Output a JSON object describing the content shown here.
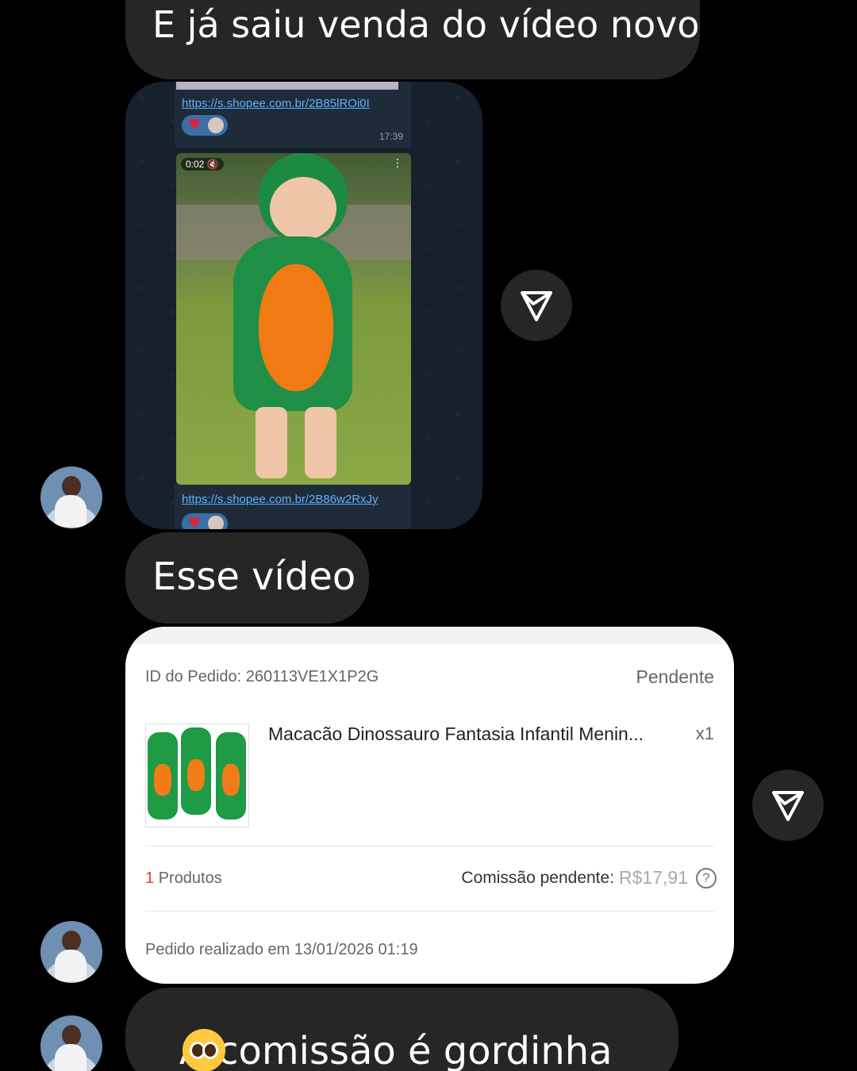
{
  "messages": {
    "m1": "E já saiu venda do vídeo novo",
    "m2": "Esse vídeo",
    "m3": "A comissão é gordinha"
  },
  "shared_screenshot": {
    "link1": "https://s.shopee.com.br/2B85lROi0I",
    "time1": "17:39",
    "video_duration": "0:02",
    "link2": "https://s.shopee.com.br/2B86w2RxJy"
  },
  "order": {
    "id_label": "ID do Pedido: 260113VE1X1P2G",
    "status": "Pendente",
    "product_name": "Macacão Dinossauro Fantasia Infantil Menin...",
    "quantity": "x1",
    "products_count": "1",
    "products_label": "Produtos",
    "commission_label": "Comissão pendente:",
    "commission_value": "R$17,91",
    "help": "?",
    "date": "Pedido realizado em 13/01/2026 01:19"
  },
  "icons": {
    "share": "send-triangle-icon",
    "reaction_heart": "heart-icon"
  },
  "colors": {
    "bubble": "#262626",
    "background": "#000000",
    "link": "#5fb0ff",
    "count_accent": "#e8402f"
  }
}
